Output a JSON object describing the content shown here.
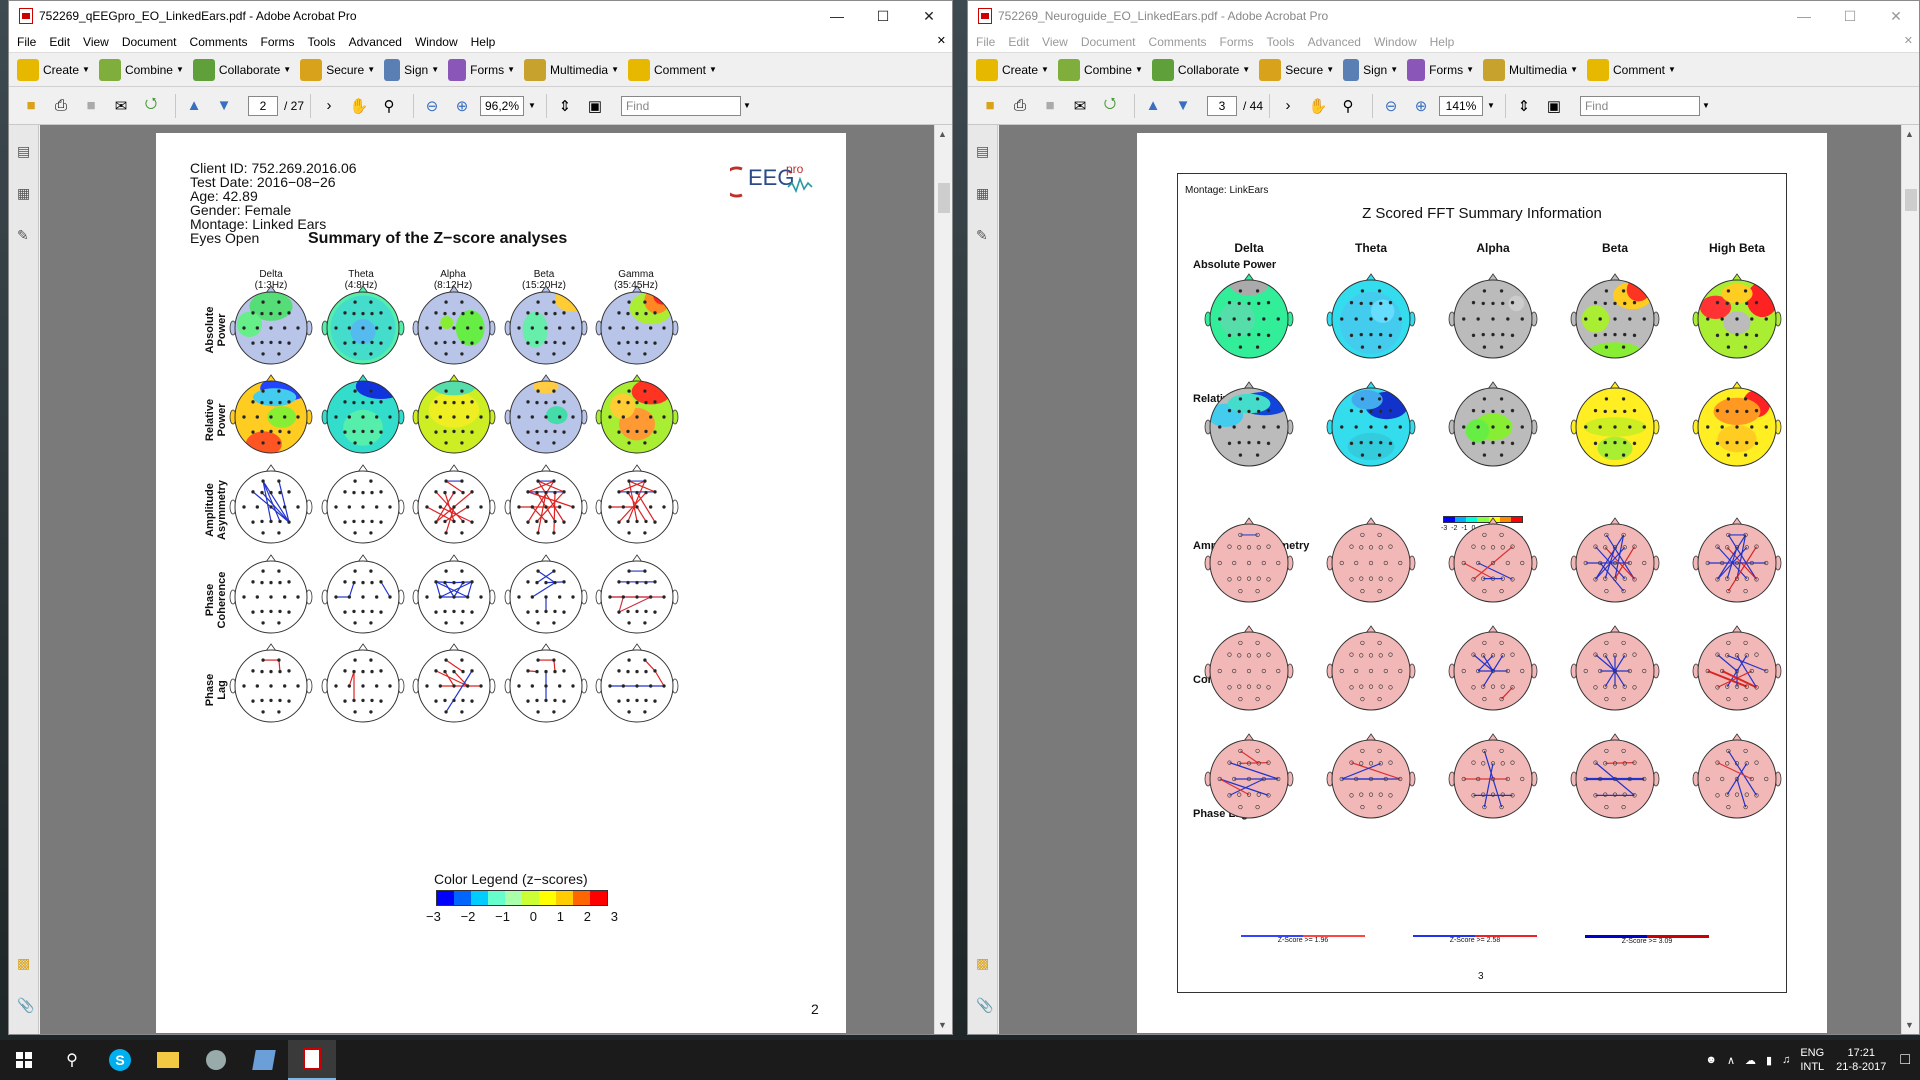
{
  "window1": {
    "title": "752269_qEEGpro_EO_LinkedEars.pdf - Adobe Acrobat Pro",
    "menu": [
      "File",
      "Edit",
      "View",
      "Document",
      "Comments",
      "Forms",
      "Tools",
      "Advanced",
      "Window",
      "Help"
    ],
    "tools": [
      "Create",
      "Combine",
      "Collaborate",
      "Secure",
      "Sign",
      "Forms",
      "Multimedia",
      "Comment"
    ],
    "page_current": "2",
    "page_total": "/ 27",
    "zoom": "96,2%",
    "find_placeholder": "Find",
    "report": {
      "client_id": "Client ID: 752.269.2016.06",
      "test_date": "Test Date: 2016−08−26",
      "age": "Age: 42.89",
      "gender": "Gender: Female",
      "montage": "Montage: Linked Ears",
      "condition": "Eyes Open",
      "logo_text": "EEG",
      "logo_sup": "pro",
      "title": "Summary of the Z−score analyses",
      "bands": [
        {
          "name": "Delta",
          "range": "(1:3Hz)"
        },
        {
          "name": "Theta",
          "range": "(4:8Hz)"
        },
        {
          "name": "Alpha",
          "range": "(8:12Hz)"
        },
        {
          "name": "Beta",
          "range": "(15:20Hz)"
        },
        {
          "name": "Gamma",
          "range": "(35:45Hz)"
        }
      ],
      "rows": [
        {
          "l1": "Absolute",
          "l2": "Power"
        },
        {
          "l1": "Relative",
          "l2": "Power"
        },
        {
          "l1": "Amplitude",
          "l2": "Asymmetry"
        },
        {
          "l1": "Phase",
          "l2": "Coherence"
        },
        {
          "l1": "Phase",
          "l2": "Lag"
        }
      ],
      "legend_title": "Color Legend (z−scores)",
      "legend_ticks": [
        "−3",
        "−2",
        "−1",
        "0",
        "1",
        "2",
        "3"
      ],
      "legend_colors": [
        "#0000ff",
        "#0066ff",
        "#00ccff",
        "#66ffcc",
        "#aaffaa",
        "#ccff33",
        "#ffff00",
        "#ffcc00",
        "#ff6600",
        "#ff0000"
      ],
      "page_number": "2"
    }
  },
  "window2": {
    "title": "752269_Neuroguide_EO_LinkedEars.pdf - Adobe Acrobat Pro",
    "menu": [
      "File",
      "Edit",
      "View",
      "Document",
      "Comments",
      "Forms",
      "Tools",
      "Advanced",
      "Window",
      "Help"
    ],
    "tools": [
      "Create",
      "Combine",
      "Collaborate",
      "Secure",
      "Sign",
      "Forms",
      "Multimedia",
      "Comment"
    ],
    "page_current": "3",
    "page_total": "/ 44",
    "zoom": "141%",
    "find_placeholder": "Find",
    "report": {
      "montage": "Montage:  LinkEars",
      "title": "Z Scored FFT Summary Information",
      "bands": [
        "Delta",
        "Theta",
        "Alpha",
        "Beta",
        "High Beta"
      ],
      "sections": [
        "Absolute Power",
        "Relative Power",
        "Amplitude Asymmetry",
        "Coherence",
        "Phase Lag"
      ],
      "colorbar_ticks": "-3 -2 -1 0 1 2 3",
      "zscore_labels": [
        "Z-Score >= 1.96",
        "Z-Score >= 2.58",
        "Z-Score >= 3.09"
      ],
      "page_number": "3"
    }
  },
  "taskbar": {
    "lang": "ENG",
    "layout": "INTL",
    "time": "17:21",
    "date": "21-8-2017"
  },
  "colors": {
    "bg_page": "#ffffff",
    "viewer_bg": "#7a7a7a",
    "pink_head": "#f2b8b8"
  }
}
